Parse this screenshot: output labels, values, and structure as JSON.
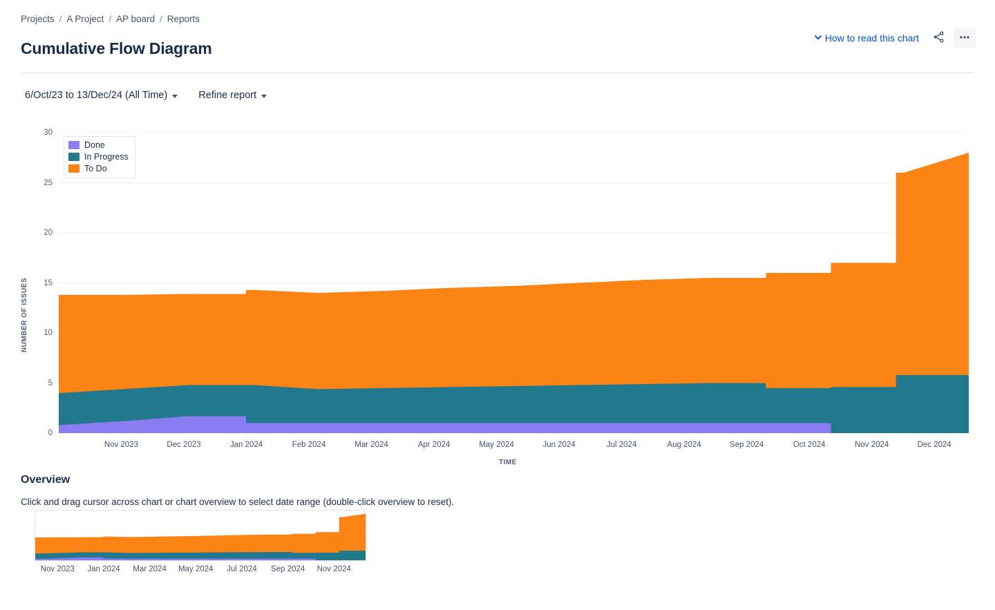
{
  "breadcrumb": {
    "items": [
      {
        "label": "Projects"
      },
      {
        "label": "A Project"
      },
      {
        "label": "AP board"
      },
      {
        "label": "Reports"
      }
    ],
    "separator": "/"
  },
  "header": {
    "title": "Cumulative Flow Diagram",
    "how_to_read_label": "How to read this chart",
    "share_icon": "share-icon",
    "more_icon": "more-options-icon"
  },
  "filters": {
    "date_range_label": "6/Oct/23 to 13/Dec/24 (All Time)",
    "refine_label": "Refine report"
  },
  "legend": {
    "items": [
      {
        "label": "Done",
        "color": "#8A7CF2"
      },
      {
        "label": "In Progress",
        "color": "#22788C"
      },
      {
        "label": "To Do",
        "color": "#FB8415"
      }
    ]
  },
  "overview": {
    "title": "Overview",
    "description": "Click and drag cursor across chart or chart overview to select date range (double-click overview to reset).",
    "xticks": [
      "Nov 2023",
      "Jan 2024",
      "Mar 2024",
      "May 2024",
      "Jul 2024",
      "Sep 2024",
      "Nov 2024"
    ]
  },
  "colors": {
    "done": "#8A7CF2",
    "in_progress": "#22788C",
    "to_do": "#FB8415",
    "grid": "#EBECF0",
    "axis_text": "#505F79",
    "link": "#0052CC",
    "text": "#172B4D"
  },
  "chart_data": {
    "type": "area",
    "stacked": true,
    "title": "Cumulative Flow Diagram",
    "xlabel": "TIME",
    "ylabel": "NUMBER OF ISSUES",
    "ylim": [
      0,
      30
    ],
    "yticks": [
      0,
      5,
      10,
      15,
      20,
      25,
      30
    ],
    "grid": true,
    "legend_position": "top-left",
    "xticks": [
      "Nov 2023",
      "Dec 2023",
      "Jan 2024",
      "Feb 2024",
      "Mar 2024",
      "Apr 2024",
      "May 2024",
      "Jun 2024",
      "Jul 2024",
      "Aug 2024",
      "Sep 2024",
      "Oct 2024",
      "Nov 2024",
      "Dec 2024"
    ],
    "x_range": "6/Oct/23 to 13/Dec/24",
    "x": [
      "Oct 2023",
      "Nov 2023",
      "Dec 2023",
      "Jan 2024",
      "Feb 2024",
      "Mar 2024",
      "Apr 2024",
      "May 2024",
      "Jun 2024",
      "Jul 2024",
      "Aug 2024",
      "Sep 2024",
      "Oct 2024",
      "Nov 2024",
      "Dec 2024"
    ],
    "series": [
      {
        "name": "Done",
        "color": "#8A7CF2",
        "values": [
          0.8,
          1.2,
          1.7,
          1.0,
          1.0,
          1.0,
          1.0,
          1.0,
          1.0,
          1.0,
          1.0,
          1.0,
          0.0,
          0.0,
          0.0
        ]
      },
      {
        "name": "In Progress",
        "color": "#22788C",
        "values": [
          3.2,
          3.2,
          3.1,
          3.8,
          3.4,
          3.5,
          3.6,
          3.7,
          3.8,
          3.9,
          4.0,
          3.5,
          4.6,
          5.8,
          5.8
        ]
      },
      {
        "name": "To Do",
        "color": "#FB8415",
        "values": [
          9.8,
          9.4,
          9.1,
          9.5,
          9.6,
          9.7,
          9.9,
          10.0,
          10.2,
          10.4,
          10.5,
          11.5,
          12.4,
          20.2,
          22.2
        ]
      }
    ],
    "cumulative_totals": [
      13.8,
      13.8,
      13.9,
      14.3,
      14.0,
      14.2,
      14.5,
      14.7,
      15.0,
      15.3,
      15.5,
      16.0,
      17.0,
      26.0,
      28.0
    ],
    "notes": "Stacked cumulative area chart: Done (bottom), In Progress (middle), To Do (top). Total rises from ~14 issues in Oct 2023 to ~28 issues by Dec 2024, with step increases in Oct and Nov 2024."
  }
}
